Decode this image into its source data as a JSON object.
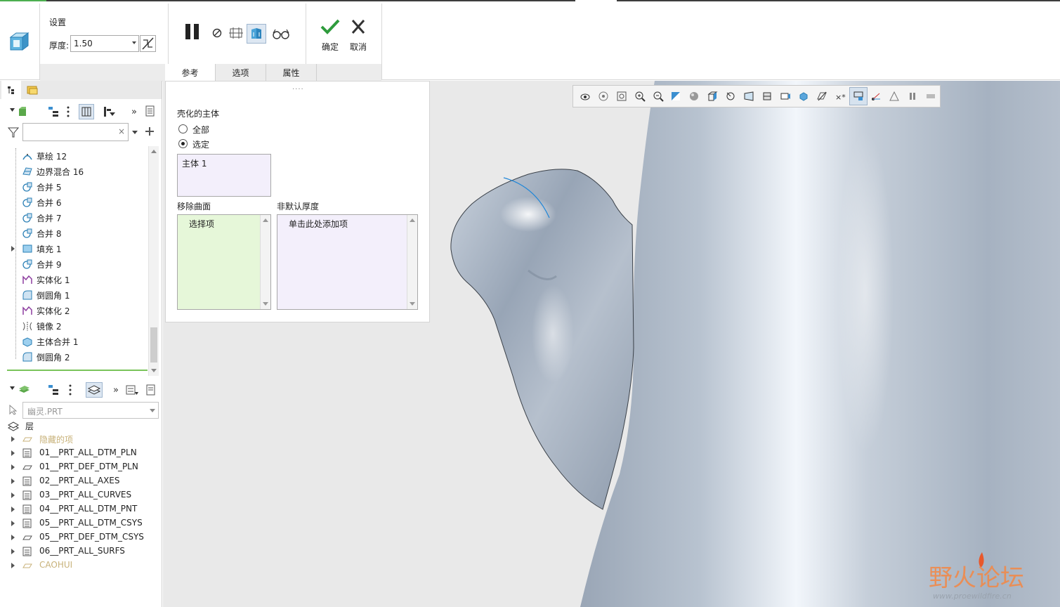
{
  "ribbon": {
    "group_title": "设置",
    "thickness_label": "厚度:",
    "thickness_value": "1.50",
    "ok_label": "确定",
    "cancel_label": "取消",
    "tabs": [
      {
        "label": "参考",
        "active": true
      },
      {
        "label": "选项",
        "active": false
      },
      {
        "label": "属性",
        "active": false
      }
    ]
  },
  "model_tree": {
    "filter_placeholder": "",
    "items": [
      {
        "label": "草绘 12",
        "icon": "sketch-icon",
        "expandable": false
      },
      {
        "label": "边界混合 16",
        "icon": "boundary-blend-icon",
        "expandable": false
      },
      {
        "label": "合并 5",
        "icon": "merge-icon",
        "expandable": false
      },
      {
        "label": "合并 6",
        "icon": "merge-icon",
        "expandable": false
      },
      {
        "label": "合并 7",
        "icon": "merge-icon",
        "expandable": false
      },
      {
        "label": "合并 8",
        "icon": "merge-icon",
        "expandable": false
      },
      {
        "label": "填充 1",
        "icon": "fill-icon",
        "expandable": true
      },
      {
        "label": "合并 9",
        "icon": "merge-icon",
        "expandable": false
      },
      {
        "label": "实体化 1",
        "icon": "solidify-icon",
        "expandable": false
      },
      {
        "label": "倒圆角 1",
        "icon": "round-icon",
        "expandable": false
      },
      {
        "label": "实体化 2",
        "icon": "solidify-icon",
        "expandable": false
      },
      {
        "label": "镜像 2",
        "icon": "mirror-icon",
        "expandable": false
      },
      {
        "label": "主体合并 1",
        "icon": "body-merge-icon",
        "expandable": false
      },
      {
        "label": "倒圆角 2",
        "icon": "round-icon",
        "expandable": false
      }
    ]
  },
  "layer_tree": {
    "part_name": "幽灵.PRT",
    "root_label": "层",
    "items": [
      {
        "label": "隐藏的项",
        "dim": true
      },
      {
        "label": "01__PRT_ALL_DTM_PLN",
        "dim": false
      },
      {
        "label": "01__PRT_DEF_DTM_PLN",
        "dim": false
      },
      {
        "label": "02__PRT_ALL_AXES",
        "dim": false
      },
      {
        "label": "03__PRT_ALL_CURVES",
        "dim": false
      },
      {
        "label": "04__PRT_ALL_DTM_PNT",
        "dim": false
      },
      {
        "label": "05__PRT_ALL_DTM_CSYS",
        "dim": false
      },
      {
        "label": "05__PRT_DEF_DTM_CSYS",
        "dim": false
      },
      {
        "label": "06__PRT_ALL_SURFS",
        "dim": false
      },
      {
        "label": "CAOHUI",
        "dim": true
      }
    ]
  },
  "references_panel": {
    "grip": "....",
    "body_title": "壳化的主体",
    "radio_all": "全部",
    "radio_selected": "选定",
    "selected_option": "选定",
    "body_item": "主体 1",
    "remove_surfaces_title": "移除曲面",
    "remove_surfaces_placeholder": "选择项",
    "non_default_thickness_title": "非默认厚度",
    "non_default_thickness_placeholder": "单击此处添加项"
  },
  "watermark": {
    "text": "野火论坛",
    "url": "www.proewildfire.cn"
  },
  "colors": {
    "accent_green": "#4caf50",
    "tree_green_line": "#7ac35a",
    "model_surface": "#a9b5c4",
    "viewport_bg": "#e9e9e9",
    "remove_box_bg": "#e6f7d9",
    "purple_box_bg": "#f3effb"
  }
}
